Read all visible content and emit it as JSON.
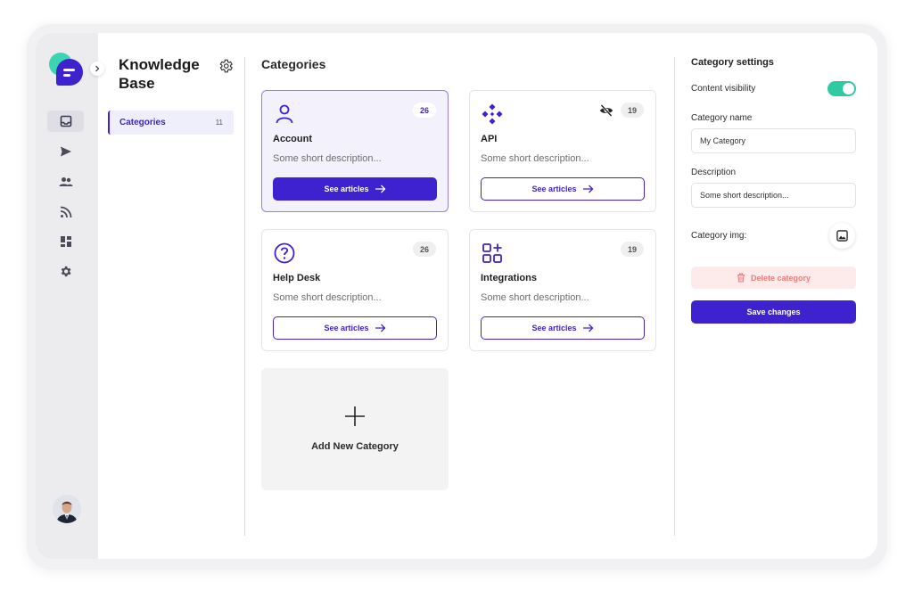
{
  "sidebar": {
    "nav_items": [
      {
        "icon": "inbox-icon",
        "active": true
      },
      {
        "icon": "send-icon",
        "active": false
      },
      {
        "icon": "people-icon",
        "active": false
      },
      {
        "icon": "rss-icon",
        "active": false
      },
      {
        "icon": "dashboard-icon",
        "active": false
      },
      {
        "icon": "gear-icon",
        "active": false
      }
    ],
    "avatar_icon": "user-avatar"
  },
  "kb": {
    "title_line1": "Knowledge",
    "title_line2": "Base",
    "nav": {
      "label": "Categories",
      "count": "11"
    }
  },
  "main": {
    "title": "Categories",
    "cards": [
      {
        "name": "Account",
        "description": "Some short description...",
        "count": "26",
        "button": "See articles",
        "icon": "user-icon",
        "selected": true,
        "hidden": false
      },
      {
        "name": "API",
        "description": "Some short description...",
        "count": "19",
        "button": "See articles",
        "icon": "api-icon",
        "selected": false,
        "hidden": true
      },
      {
        "name": "Help Desk",
        "description": "Some short description...",
        "count": "26",
        "button": "See articles",
        "icon": "question-circle-icon",
        "selected": false,
        "hidden": false
      },
      {
        "name": "Integrations",
        "description": "Some short description...",
        "count": "19",
        "button": "See articles",
        "icon": "apps-add-icon",
        "selected": false,
        "hidden": false
      }
    ],
    "add_label": "Add New Category"
  },
  "settings": {
    "title": "Category settings",
    "visibility_label": "Content visibility",
    "visibility_on": true,
    "name_label": "Category name",
    "name_value": "My Category",
    "description_label": "Description",
    "description_value": "Some short description...",
    "img_label": "Category img:",
    "delete_label": "Delete category",
    "save_label": "Save changes"
  },
  "colors": {
    "accent": "#3f22cf",
    "teal": "#2fc9a4",
    "danger": "#f07a7a"
  }
}
